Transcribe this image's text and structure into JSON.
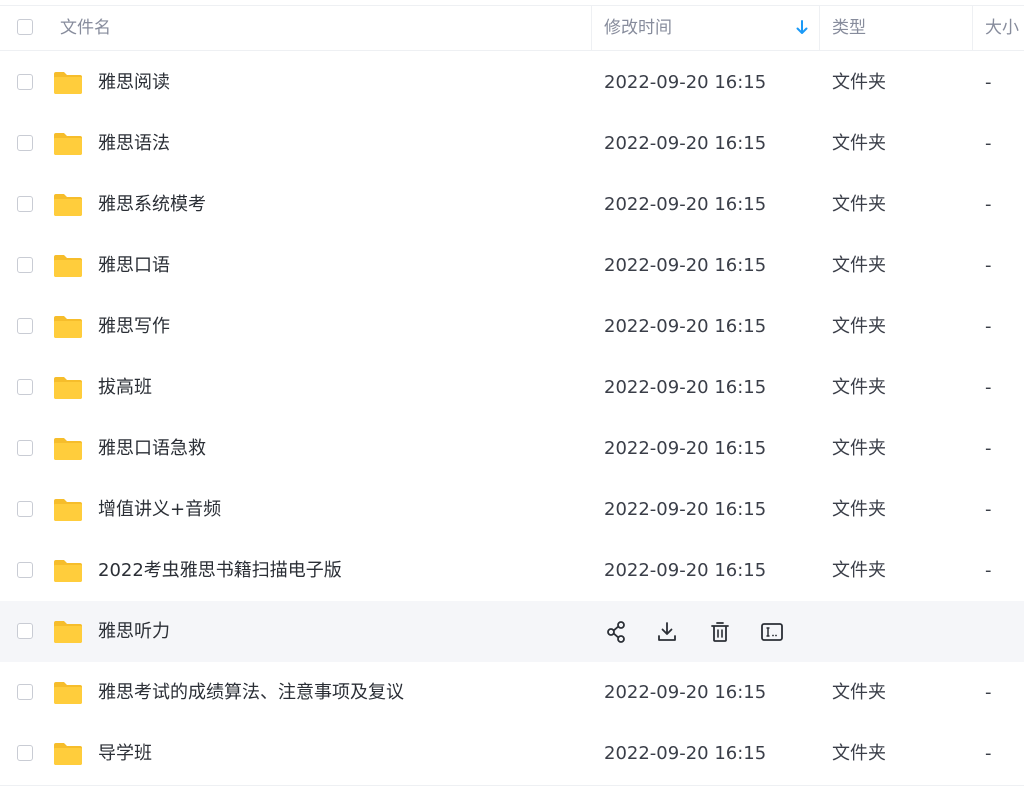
{
  "header": {
    "name": "文件名",
    "modified": "修改时间",
    "type": "类型",
    "size": "大小"
  },
  "colors": {
    "folder": "#ffcd3c",
    "folder_dark": "#f6bd2b",
    "sort_arrow": "#1b9af7",
    "hover_row": "#f5f6f9",
    "action_icon": "#2b2f36"
  },
  "icons": {
    "sort": "arrow-down-icon",
    "folder": "folder-icon",
    "share": "share-icon",
    "download": "download-icon",
    "delete": "trash-icon",
    "rename": "rename-icon"
  },
  "rows": [
    {
      "name": "雅思阅读",
      "modified": "2022-09-20 16:15",
      "type": "文件夹",
      "size": "-"
    },
    {
      "name": "雅思语法",
      "modified": "2022-09-20 16:15",
      "type": "文件夹",
      "size": "-"
    },
    {
      "name": "雅思系统模考",
      "modified": "2022-09-20 16:15",
      "type": "文件夹",
      "size": "-"
    },
    {
      "name": "雅思口语",
      "modified": "2022-09-20 16:15",
      "type": "文件夹",
      "size": "-"
    },
    {
      "name": "雅思写作",
      "modified": "2022-09-20 16:15",
      "type": "文件夹",
      "size": "-"
    },
    {
      "name": "拔高班",
      "modified": "2022-09-20 16:15",
      "type": "文件夹",
      "size": "-"
    },
    {
      "name": "雅思口语急救",
      "modified": "2022-09-20 16:15",
      "type": "文件夹",
      "size": "-"
    },
    {
      "name": "增值讲义+音频",
      "modified": "2022-09-20 16:15",
      "type": "文件夹",
      "size": "-"
    },
    {
      "name": "2022考虫雅思书籍扫描电子版",
      "modified": "2022-09-20 16:15",
      "type": "文件夹",
      "size": "-"
    },
    {
      "name": "雅思听力",
      "hovered": true
    },
    {
      "name": "雅思考试的成绩算法、注意事项及复议",
      "modified": "2022-09-20 16:15",
      "type": "文件夹",
      "size": "-"
    },
    {
      "name": "导学班",
      "modified": "2022-09-20 16:15",
      "type": "文件夹",
      "size": "-"
    }
  ]
}
